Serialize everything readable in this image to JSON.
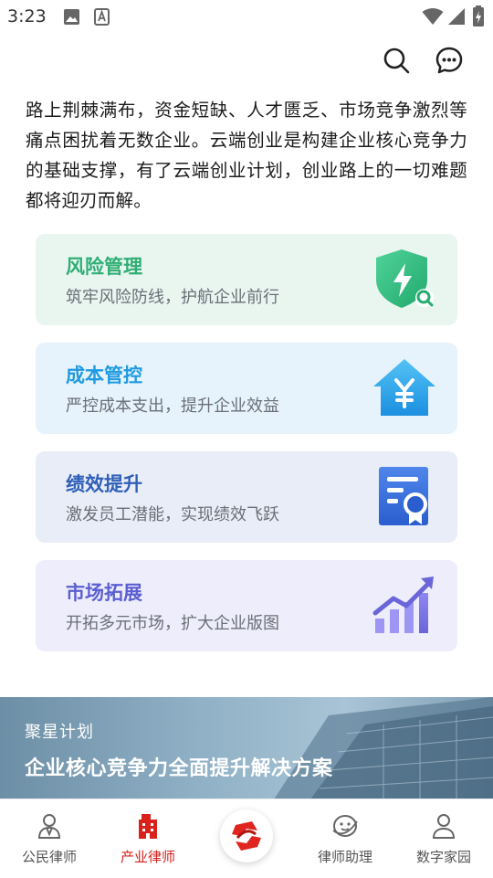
{
  "status": {
    "time": "3:23"
  },
  "intro_text": "路上荆棘满布，资金短缺、人才匮乏、市场竞争激烈等痛点困扰着无数企业。云端创业是构建企业核心竞争力的基础支撑，有了云端创业计划，创业路上的一切难题都将迎刃而解。",
  "cards": [
    {
      "title": "风险管理",
      "desc": "筑牢风险防线，护航企业前行",
      "icon": "shield-lightning-icon",
      "bg": "#e9f6f0",
      "color": "#2fae74"
    },
    {
      "title": "成本管控",
      "desc": "严控成本支出，提升企业效益",
      "icon": "yen-house-icon",
      "bg": "#e6f3fc",
      "color": "#1f9ae0"
    },
    {
      "title": "绩效提升",
      "desc": "激发员工潜能，实现绩效飞跃",
      "icon": "certificate-icon",
      "bg": "#e8edf8",
      "color": "#2f5fb8"
    },
    {
      "title": "市场拓展",
      "desc": "开拓多元市场，扩大企业版图",
      "icon": "growth-chart-icon",
      "bg": "#eeedfb",
      "color": "#5a5fd0"
    }
  ],
  "banner": {
    "subtitle": "聚星计划",
    "title": "企业核心竞争力全面提升解决方案"
  },
  "tabs": [
    {
      "label": "公民律师",
      "icon": "lawyer-icon",
      "active": false
    },
    {
      "label": "产业律师",
      "icon": "building-icon",
      "active": true
    },
    {
      "label": "",
      "icon": "app-logo-icon",
      "active": false
    },
    {
      "label": "律师助理",
      "icon": "assistant-chat-icon",
      "active": false
    },
    {
      "label": "数字家园",
      "icon": "user-icon",
      "active": false
    }
  ],
  "colors": {
    "accent": "#d9201b"
  }
}
